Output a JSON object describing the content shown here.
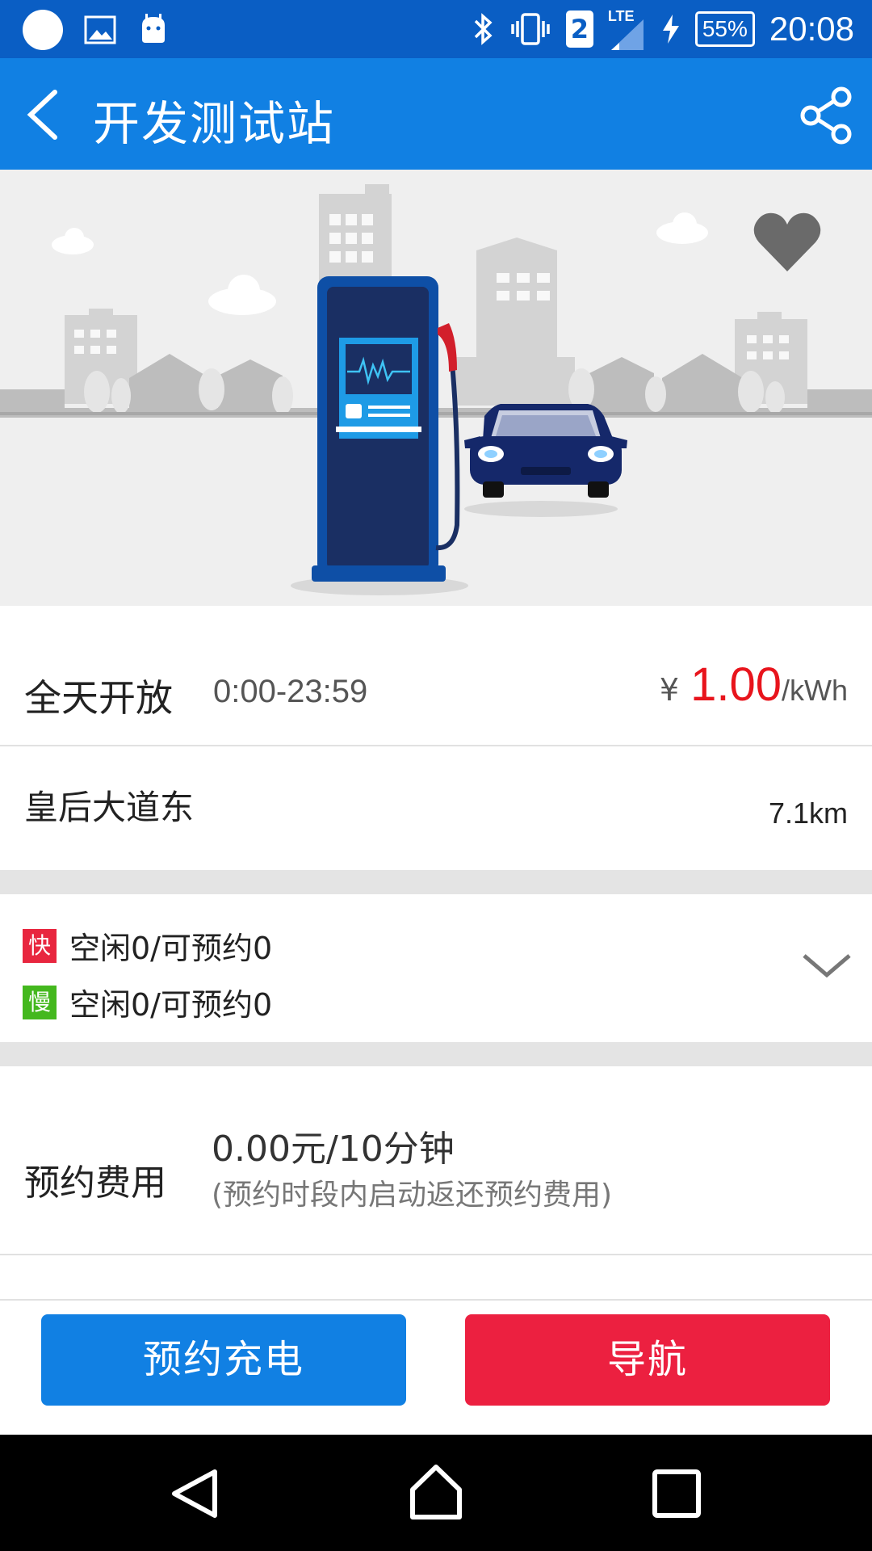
{
  "status_bar": {
    "time": "20:08",
    "battery": "55%",
    "sim": "2",
    "network": "LTE",
    "icons": [
      "circle-icon",
      "image-icon",
      "android-icon",
      "bluetooth-icon",
      "vibrate-icon",
      "sim-icon",
      "signal-icon",
      "charging-icon",
      "battery-icon"
    ]
  },
  "app_bar": {
    "title": "开发测试站",
    "back_icon": "back-arrow-icon",
    "share_icon": "share-icon"
  },
  "hero": {
    "favorite_icon": "heart-icon"
  },
  "hours": {
    "label": "全天开放",
    "time": "0:00-23:59",
    "currency": "¥",
    "price": "1.00",
    "unit": "/kWh"
  },
  "address": {
    "label": "皇后大道东",
    "distance": "7.1km"
  },
  "piles": {
    "fast": {
      "badge": "快",
      "text": "空闲0/可预约0",
      "color": "#e8263f"
    },
    "slow": {
      "badge": "慢",
      "text": "空闲0/可预约0",
      "color": "#44b81e"
    }
  },
  "reservation_fee": {
    "label": "预约费用",
    "value": "0.00元/10分钟",
    "note": "(预约时段内启动返还预约费用)"
  },
  "buttons": {
    "reserve": "预约充电",
    "navigate": "导航"
  },
  "colors": {
    "status_bar": "#0a5ec4",
    "app_bar": "#1180e3",
    "price": "#e8141c",
    "navigate_button": "#ec2040"
  }
}
